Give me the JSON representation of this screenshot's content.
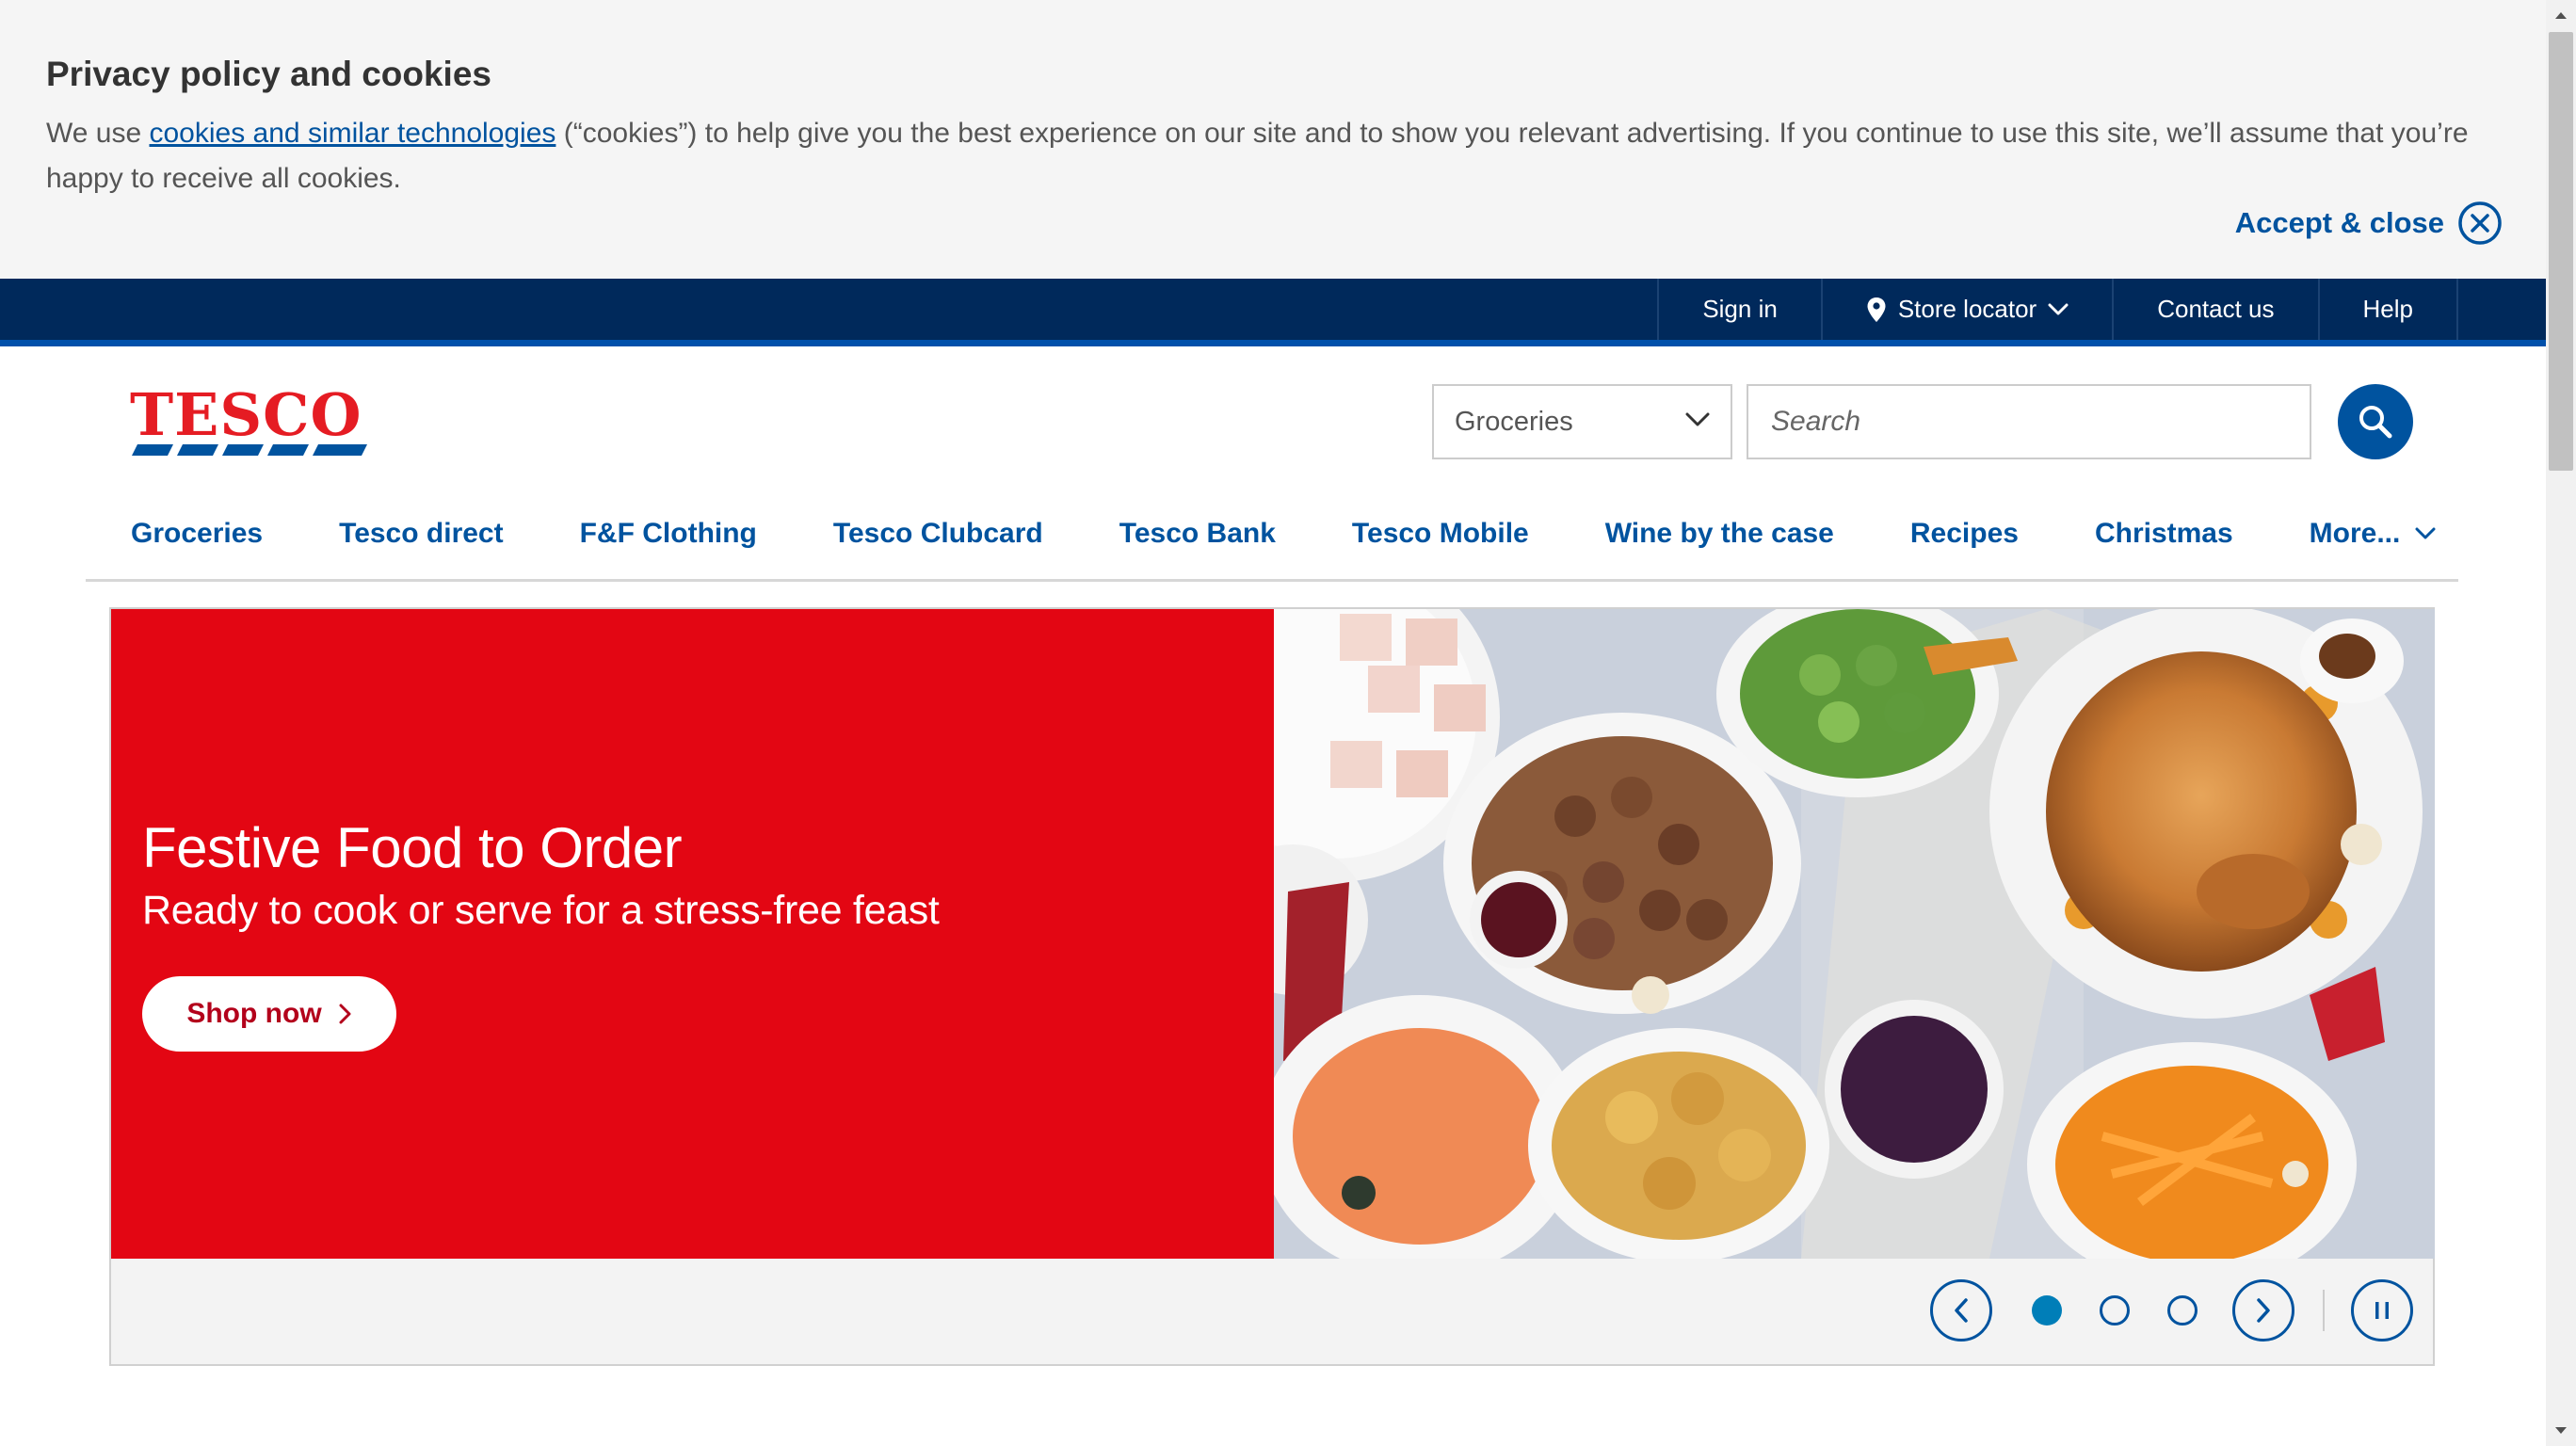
{
  "cookie_banner": {
    "title": "Privacy policy and cookies",
    "text_before_link": "We use ",
    "link_text": "cookies and similar technologies",
    "text_after_link": " (“cookies”) to help give you the best experience on our site and to show you relevant advertising. If you continue to use this site, we’ll assume that you’re happy to receive all cookies.",
    "accept_label": "Accept & close"
  },
  "utility_nav": {
    "sign_in": "Sign in",
    "store_locator": "Store locator",
    "contact_us": "Contact us",
    "help": "Help"
  },
  "header": {
    "logo_text": "TESCO",
    "search_department": "Groceries",
    "search_placeholder": "Search"
  },
  "main_nav": {
    "items": [
      "Groceries",
      "Tesco direct",
      "F&F Clothing",
      "Tesco Clubcard",
      "Tesco Bank",
      "Tesco Mobile",
      "Wine by the case",
      "Recipes",
      "Christmas"
    ],
    "more_label": "More..."
  },
  "hero": {
    "title": "Festive Food to Order",
    "subtitle": "Ready to cook or serve for a stress-free feast",
    "cta": "Shop now",
    "image_description": "festive-food-spread",
    "current_slide": 1,
    "total_slides": 3
  },
  "colors": {
    "brand_blue": "#00539f",
    "dark_navy": "#00295b",
    "tesco_red": "#e30613",
    "active_dot": "#007eb8"
  }
}
